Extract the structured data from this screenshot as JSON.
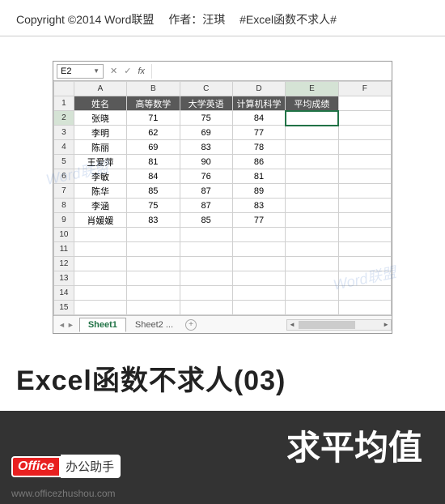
{
  "header": {
    "copyright": "Copyright ©2014 Word联盟",
    "author": "作者：汪琪",
    "series": "#Excel函数不求人#"
  },
  "watermarks": {
    "w1": "Word联盟",
    "w2": "Word联盟"
  },
  "excel": {
    "name_box": "E2",
    "formula": "",
    "columns": [
      "A",
      "B",
      "C",
      "D",
      "E",
      "F"
    ],
    "header_row": [
      "姓名",
      "高等数学",
      "大学英语",
      "计算机科学",
      "平均成绩",
      ""
    ],
    "rows": [
      [
        "张晓",
        "71",
        "75",
        "84",
        "",
        ""
      ],
      [
        "李明",
        "62",
        "69",
        "77",
        "",
        ""
      ],
      [
        "陈丽",
        "69",
        "83",
        "78",
        "",
        ""
      ],
      [
        "王爱萍",
        "81",
        "90",
        "86",
        "",
        ""
      ],
      [
        "李敏",
        "84",
        "76",
        "81",
        "",
        ""
      ],
      [
        "陈华",
        "85",
        "87",
        "89",
        "",
        ""
      ],
      [
        "李涵",
        "75",
        "87",
        "83",
        "",
        ""
      ],
      [
        "肖媛媛",
        "83",
        "85",
        "77",
        "",
        ""
      ]
    ],
    "selected_cell": "E2",
    "tabs": {
      "active": "Sheet1",
      "other": "Sheet2 ..."
    }
  },
  "title": "Excel函数不求人(03)",
  "subtitle": "求平均值",
  "badge": {
    "red": "Office",
    "white": "办公助手"
  },
  "url": "www.officezhushou.com"
}
